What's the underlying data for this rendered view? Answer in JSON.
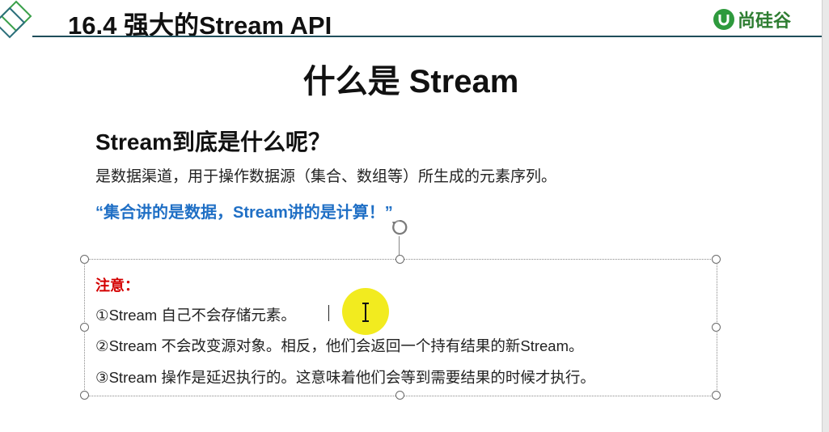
{
  "header": {
    "title": "16.4 强大的Stream API",
    "brand_text": "尚硅谷",
    "accent_color": "#1e4d5a",
    "brand_color": "#2e9a3d",
    "logo_icon": "diamond-logo-icon",
    "brand_icon": "u-logo-icon"
  },
  "slide": {
    "title": "什么是 Stream",
    "question": "Stream到底是什么呢？",
    "definition": "是数据渠道，用于操作数据源（集合、数组等）所生成的元素序列。",
    "quote": "“集合讲的是数据，Stream讲的是计算！”",
    "quote_color": "#1f6fc5"
  },
  "notes": {
    "label": "注意：",
    "label_color": "#d40000",
    "items": [
      "①Stream 自己不会存储元素。",
      "②Stream 不会改变源对象。相反，他们会返回一个持有结果的新Stream。",
      "③Stream 操作是延迟执行的。这意味着他们会等到需要结果的时候才执行。"
    ]
  },
  "cursor": {
    "type": "ibeam-cursor-icon",
    "highlight_color": "#f0e800"
  }
}
